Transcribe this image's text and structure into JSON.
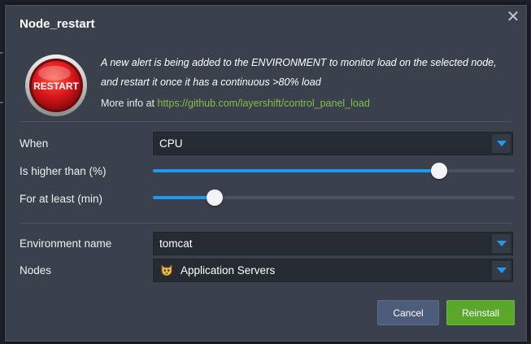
{
  "dialog": {
    "title": "Node_restart",
    "close_icon": "close-icon"
  },
  "info": {
    "icon": "restart-button-icon",
    "icon_text": "RESTART",
    "description": "A new alert is being added to the ENVIRONMENT to monitor load on the selected node, and restart it once it has a continuous >80% load",
    "more_prefix": "More info at",
    "more_link": "https://github.com/layershift/control_panel_load"
  },
  "form": {
    "when": {
      "label": "When",
      "value": "CPU"
    },
    "higher_than": {
      "label": "Is higher than (%)",
      "level": 0.79
    },
    "for_at_least": {
      "label": "For at least (min)",
      "level": 0.17
    },
    "environment": {
      "label": "Environment name",
      "value": "tomcat"
    },
    "nodes": {
      "label": "Nodes",
      "value": "Application Servers",
      "icon": "tomcat-icon"
    }
  },
  "buttons": {
    "cancel": "Cancel",
    "reinstall": "Reinstall"
  },
  "colors": {
    "accent": "#1a9bf0",
    "link": "#7fc14a",
    "primary_button": "#5aa72c",
    "secondary_button": "#4e5c7c"
  }
}
